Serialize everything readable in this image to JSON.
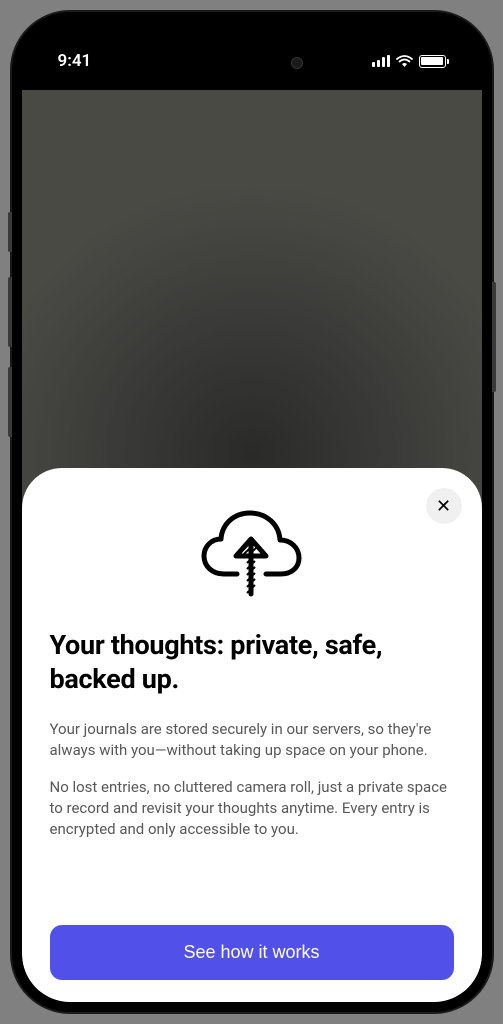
{
  "statusBar": {
    "time": "9:41"
  },
  "sheet": {
    "title": "Your thoughts: private, safe, backed up.",
    "paragraph1": "Your journals are stored securely in our servers, so they're always with you—without taking up space on your phone.",
    "paragraph2": "No lost entries, no cluttered camera roll, just a private space to record and revisit your thoughts anytime. Every entry is encrypted and only accessible to you.",
    "cta": "See how it works",
    "closeLabel": "✕"
  }
}
